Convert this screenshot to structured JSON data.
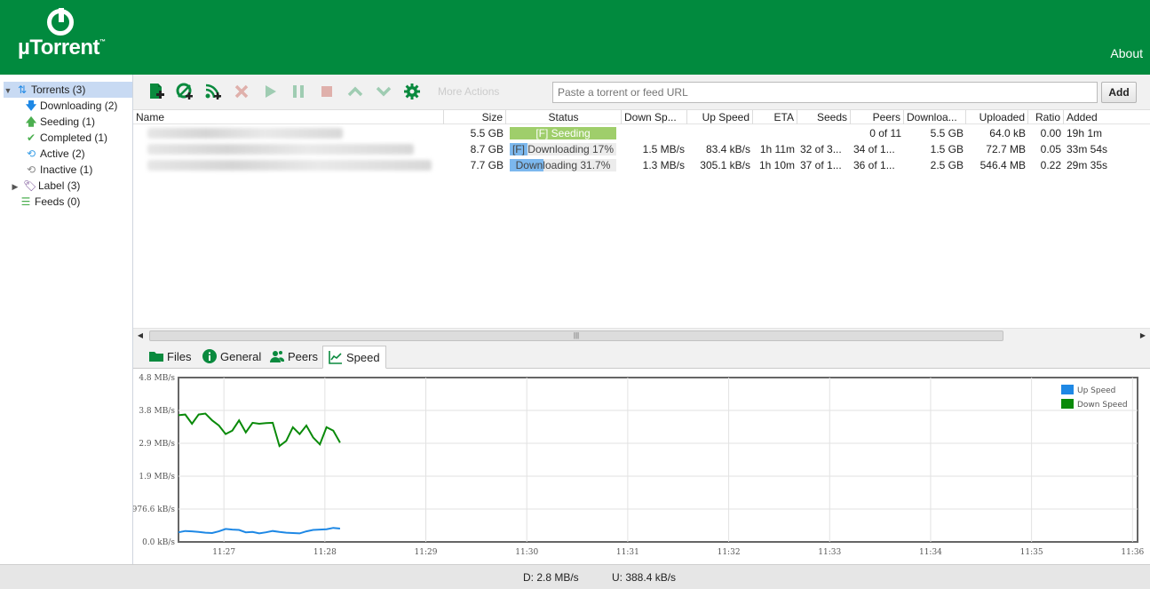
{
  "header": {
    "app_name": "µTorrent",
    "tm": "™",
    "about_label": "About",
    "brand_color": "#018a3e"
  },
  "sidebar": {
    "items": [
      {
        "label": "Torrents (3)",
        "icon": "torrents-icon"
      },
      {
        "label": "Downloading (2)",
        "icon": "arrow-down-icon"
      },
      {
        "label": "Seeding (1)",
        "icon": "arrow-up-icon"
      },
      {
        "label": "Completed (1)",
        "icon": "check-icon"
      },
      {
        "label": "Active (2)",
        "icon": "refresh-icon"
      },
      {
        "label": "Inactive (1)",
        "icon": "refresh-gray-icon"
      },
      {
        "label": "Label (3)",
        "icon": "tag-icon"
      },
      {
        "label": "Feeds (0)",
        "icon": "rss-icon"
      }
    ]
  },
  "toolbar": {
    "more_actions_label": "More Actions",
    "url_placeholder": "Paste a torrent or feed URL",
    "add_label": "Add"
  },
  "list": {
    "columns": [
      "Name",
      "Size",
      "Status",
      "Down Sp...",
      "Up Speed",
      "ETA",
      "Seeds",
      "Peers",
      "Downloa...",
      "Uploaded",
      "Ratio",
      "Added"
    ],
    "rows": [
      {
        "size": "5.5 GB",
        "status": "[F] Seeding",
        "progress": 100,
        "seeding": true,
        "down": "",
        "up": "",
        "eta": "",
        "seeds": "",
        "peers": "0 of 11",
        "downloaded": "5.5 GB",
        "uploaded": "64.0 kB",
        "ratio": "0.00",
        "added": "19h 1m"
      },
      {
        "size": "8.7 GB",
        "status": "[F] Downloading 17%",
        "progress": 17,
        "seeding": false,
        "down": "1.5 MB/s",
        "up": "83.4 kB/s",
        "eta": "1h 11m",
        "seeds": "32 of 3...",
        "peers": "34 of 1...",
        "downloaded": "1.5 GB",
        "uploaded": "72.7 MB",
        "ratio": "0.05",
        "added": "33m 54s"
      },
      {
        "size": "7.7 GB",
        "status": "Downloading 31.7%",
        "progress": 31.7,
        "seeding": false,
        "down": "1.3 MB/s",
        "up": "305.1 kB/s",
        "eta": "1h 10m",
        "seeds": "37 of 1...",
        "peers": "36 of 1...",
        "downloaded": "2.5 GB",
        "uploaded": "546.4 MB",
        "ratio": "0.22",
        "added": "29m 35s"
      }
    ]
  },
  "tabs": [
    {
      "label": "Files",
      "icon": "folder-icon",
      "active": false
    },
    {
      "label": "General",
      "icon": "info-icon",
      "active": false
    },
    {
      "label": "Peers",
      "icon": "peers-icon",
      "active": false
    },
    {
      "label": "Speed",
      "icon": "speed-chart-icon",
      "active": true
    }
  ],
  "chart_data": {
    "type": "line",
    "title": "",
    "xlabel": "",
    "ylabel": "",
    "y_tick_labels": [
      "0.0 kB/s",
      "976.6 kB/s",
      "1.9 MB/s",
      "2.9 MB/s",
      "3.8 MB/s",
      "4.8 MB/s"
    ],
    "ylim_mb": [
      0,
      4.8
    ],
    "x_tick_labels": [
      "11:27",
      "11:28",
      "11:29",
      "11:30",
      "11:31",
      "11:32",
      "11:33",
      "11:34",
      "11:35",
      "11:36"
    ],
    "legend_position": "top-right",
    "series": [
      {
        "name": "Up Speed",
        "color": "#1e88e5",
        "values": [
          0.28,
          0.32,
          0.31,
          0.29,
          0.27,
          0.26,
          0.31,
          0.38,
          0.36,
          0.35,
          0.28,
          0.29,
          0.25,
          0.28,
          0.32,
          0.29,
          0.27,
          0.26,
          0.25,
          0.31,
          0.35,
          0.36,
          0.37,
          0.41,
          0.39
        ]
      },
      {
        "name": "Down Speed",
        "color": "#0a8a0a",
        "values": [
          3.7,
          3.72,
          3.45,
          3.72,
          3.75,
          3.55,
          3.4,
          3.15,
          3.25,
          3.55,
          3.2,
          3.48,
          3.45,
          3.47,
          3.48,
          2.8,
          2.95,
          3.35,
          3.15,
          3.4,
          3.05,
          2.85,
          3.35,
          3.25,
          2.9
        ]
      }
    ],
    "x_start_minutes": 26.55,
    "x_end_minutes": 28.15
  },
  "status": {
    "down_label": "D: 2.8 MB/s",
    "up_label": "U: 388.4 kB/s"
  }
}
